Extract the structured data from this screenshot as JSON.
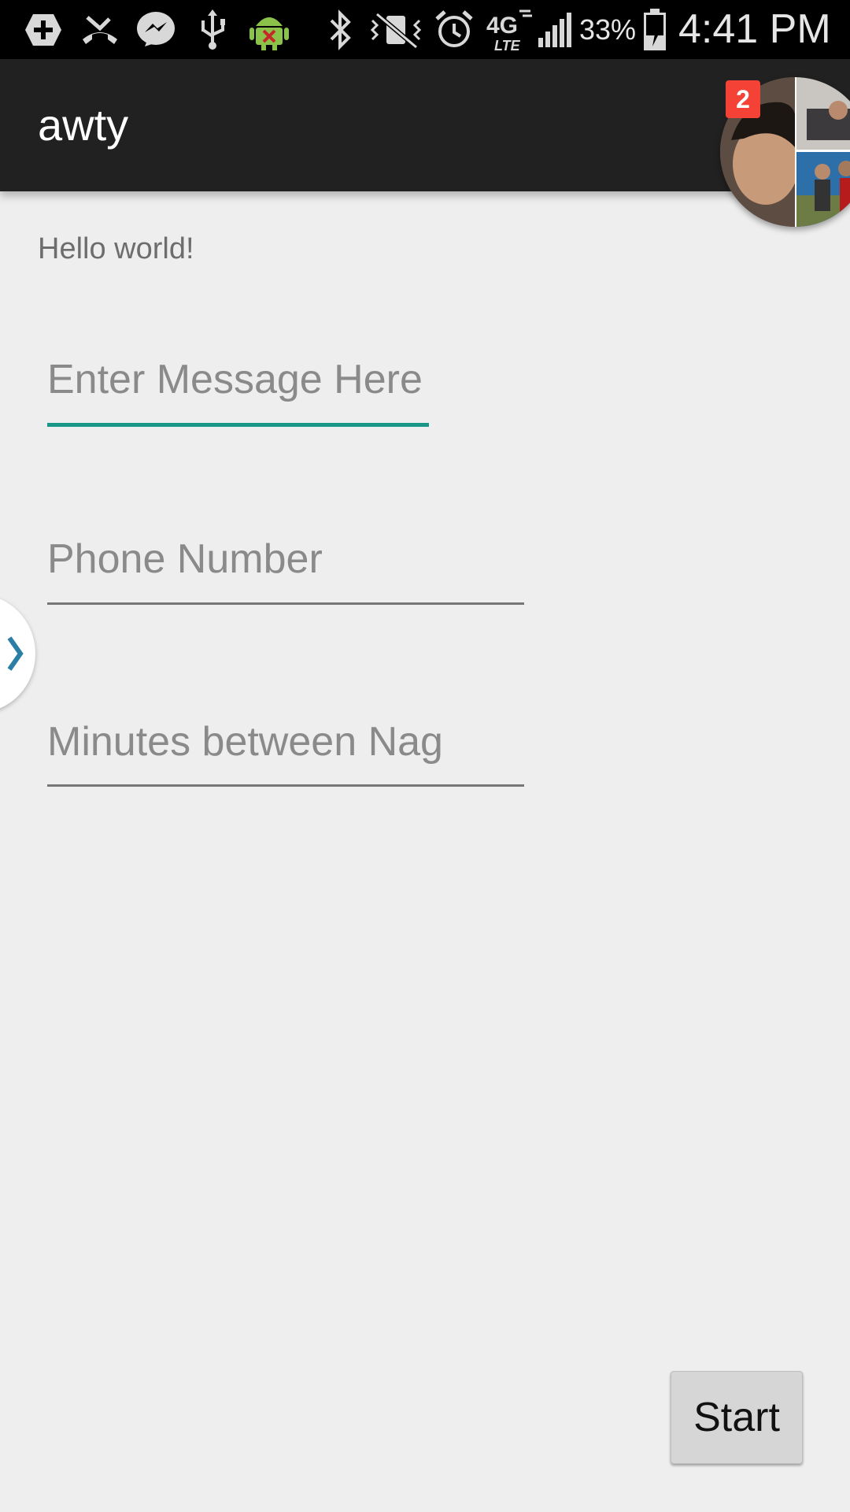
{
  "status_bar": {
    "battery_percent": "33%",
    "time": "4:41 PM",
    "network_label": "4G LTE",
    "icons": [
      "plus-box-icon",
      "missed-call-icon",
      "messenger-icon",
      "usb-icon",
      "android-debug-icon",
      "bluetooth-icon",
      "vibrate-icon",
      "alarm-icon",
      "network-4g-lte-icon",
      "signal-icon",
      "battery-charging-icon"
    ]
  },
  "app_bar": {
    "title": "awty",
    "background": "#212121"
  },
  "chat_head": {
    "badge_count": "2",
    "badge_color": "#f44336"
  },
  "content": {
    "hello_text": "Hello world!",
    "fields": {
      "message": {
        "placeholder": "Enter Message Here",
        "value": ""
      },
      "phone": {
        "placeholder": "Phone Number",
        "value": ""
      },
      "minutes": {
        "placeholder": "Minutes between Nag",
        "value": ""
      }
    },
    "accent_color": "#1a9688"
  },
  "actions": {
    "start_label": "Start"
  }
}
